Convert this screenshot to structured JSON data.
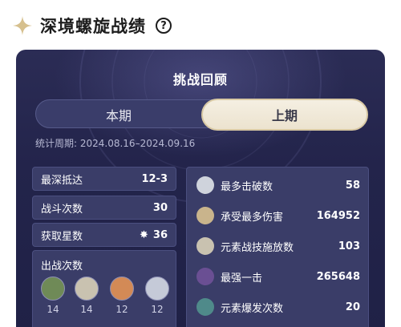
{
  "header": {
    "title": "深境螺旋战绩",
    "help_icon": "?"
  },
  "panel": {
    "title": "挑战回顾",
    "tabs": [
      {
        "label": "本期",
        "selected": false
      },
      {
        "label": "上期",
        "selected": true
      }
    ],
    "period": "统计周期: 2024.08.16–2024.09.16"
  },
  "left_stats": [
    {
      "label": "最深抵达",
      "value": "12-3"
    },
    {
      "label": "战斗次数",
      "value": "30"
    },
    {
      "label": "获取星数",
      "value": "36",
      "icon": "star-icon"
    }
  ],
  "battle_counts": {
    "label": "出战次数",
    "characters": [
      {
        "count": "14",
        "color": "#6f8a57"
      },
      {
        "count": "14",
        "color": "#c9c2b0"
      },
      {
        "count": "12",
        "color": "#d38a56"
      },
      {
        "count": "12",
        "color": "#c5cad8"
      }
    ]
  },
  "right_stats": [
    {
      "label": "最多击破数",
      "value": "58",
      "color": "#cfd3dc"
    },
    {
      "label": "承受最多伤害",
      "value": "164952",
      "color": "#c9b48c"
    },
    {
      "label": "元素战技施放数",
      "value": "103",
      "color": "#c9c2b0"
    },
    {
      "label": "最强一击",
      "value": "265648",
      "color": "#6a4f93"
    },
    {
      "label": "元素爆发次数",
      "value": "20",
      "color": "#4f8a8a"
    }
  ],
  "colors": {
    "panel_bg": "#23244b",
    "tab_selected_bg": "#f0e8d6",
    "row_bg": "#3a3d68"
  }
}
